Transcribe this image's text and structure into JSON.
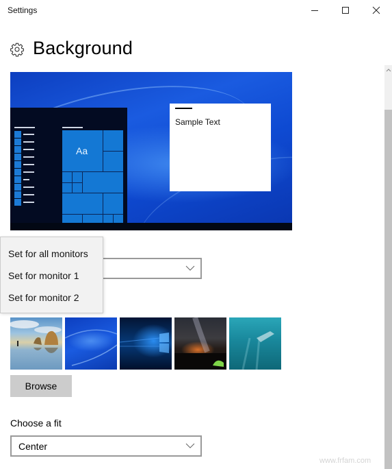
{
  "window": {
    "title": "Settings",
    "controls": {
      "minimize_icon": "minimize-icon",
      "maximize_icon": "maximize-icon",
      "close_icon": "close-icon"
    }
  },
  "header": {
    "icon": "gear-icon",
    "title": "Background"
  },
  "preview": {
    "sample_text": "Sample Text",
    "tile_label": "Aa"
  },
  "monitor_flyout": {
    "items": [
      {
        "label": "Set for all monitors"
      },
      {
        "label": "Set for monitor 1"
      },
      {
        "label": "Set for monitor 2"
      }
    ]
  },
  "background_combo": {
    "value": "",
    "icon": "chevron-down-icon"
  },
  "pictures": {
    "thumbnails": [
      {
        "name": "beach-rocks-thumbnail"
      },
      {
        "name": "blue-light-thumbnail"
      },
      {
        "name": "windows-logo-thumbnail"
      },
      {
        "name": "night-sky-tent-thumbnail"
      },
      {
        "name": "underwater-swimmer-thumbnail"
      }
    ],
    "browse_label": "Browse"
  },
  "fit": {
    "label": "Choose a fit",
    "value": "Center"
  },
  "watermark": "www.frfam.com",
  "colors": {
    "accent_tile": "#1478d4",
    "desktop_blue": "#1a5be0",
    "flyout_bg": "#f2f2f2",
    "button_bg": "#cccccc"
  }
}
